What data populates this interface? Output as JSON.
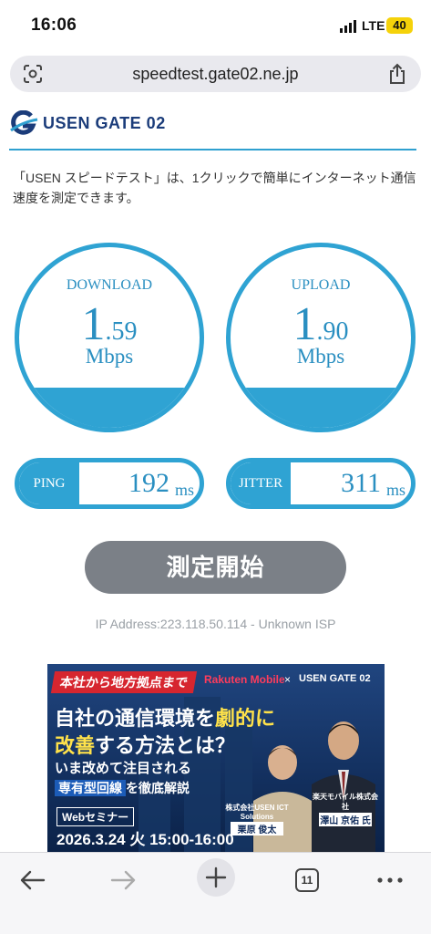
{
  "status_bar": {
    "time": "16:06",
    "network": "LTE",
    "battery": "40"
  },
  "browser": {
    "url": "speedtest.gate02.ne.jp",
    "tab_count": "11"
  },
  "site": {
    "logo_text": "USEN GATE 02",
    "description": "「USEN スピードテスト」は、1クリックで簡単にインターネット通信速度を測定できます。"
  },
  "results": {
    "download": {
      "label": "DOWNLOAD",
      "int": "1",
      "dec": ".59",
      "unit": "Mbps"
    },
    "upload": {
      "label": "UPLOAD",
      "int": "1",
      "dec": ".90",
      "unit": "Mbps"
    },
    "ping": {
      "label": "PING",
      "value": "192",
      "unit": "ms"
    },
    "jitter": {
      "label": "JITTER",
      "value": "311",
      "unit": "ms"
    }
  },
  "start_button": {
    "label": "測定開始"
  },
  "ip_info": "IP Address:223.118.50.114 - Unknown ISP",
  "banner": {
    "tag": "本社から地方拠点まで",
    "partner": "Rakuten Mobile",
    "times": "×",
    "brand": "USEN GATE 02",
    "headline1_a": "自社の通信環境を",
    "headline1_b": "劇的に",
    "headline2_a": "改善",
    "headline2_b": "する方法とは？",
    "sub1": "いま改めて注目される",
    "sub2_box": "専有型回線",
    "sub2_rest": "を徹底解説",
    "web_label": "Webセミナー",
    "date": "2026.3.24 火 15:00-16:00",
    "speaker1_company": "株式会社USEN ICT Solutions",
    "speaker1_name": "栗原 俊太",
    "speaker2_company": "楽天モバイル株式会社",
    "speaker2_name": "澤山 京佑 氏"
  },
  "colors": {
    "accent": "#2fa3d3",
    "button": "#7b8087",
    "brand": "#1b3c7a"
  }
}
